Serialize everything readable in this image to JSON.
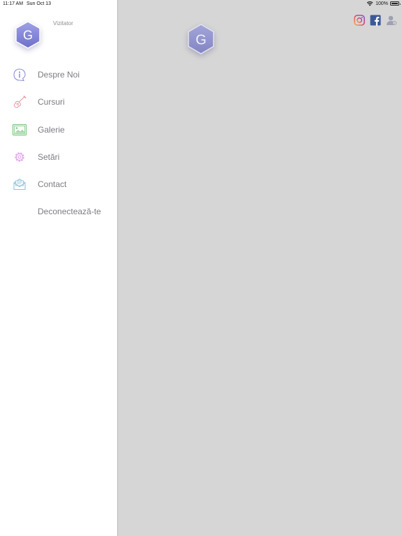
{
  "status_bar": {
    "time": "11:17 AM",
    "date": "Sun Oct 13",
    "battery": "100%"
  },
  "side_menu": {
    "avatar_letter": "G",
    "user_label": "Vizitator",
    "items": [
      {
        "label": "Despre Noi",
        "icon": "info-icon",
        "color": "#8f90d8"
      },
      {
        "label": "Cursuri",
        "icon": "guitar-icon",
        "color": "#e8a0a8"
      },
      {
        "label": "Galerie",
        "icon": "image-icon",
        "color": "#7ec782"
      },
      {
        "label": "Setări",
        "icon": "gear-icon",
        "color": "#d79ae3"
      },
      {
        "label": "Contact",
        "icon": "mail-icon",
        "color": "#8ec5dc"
      },
      {
        "label": "Deconectează-te",
        "icon": "",
        "color": ""
      }
    ]
  },
  "main": {
    "logo_letter": "G",
    "social_icons": [
      "instagram-icon",
      "facebook-icon",
      "user-icon"
    ]
  },
  "colors": {
    "accent": "#7d7fd2",
    "overlay": "#d6d6d6",
    "facebook": "#3b5998"
  }
}
